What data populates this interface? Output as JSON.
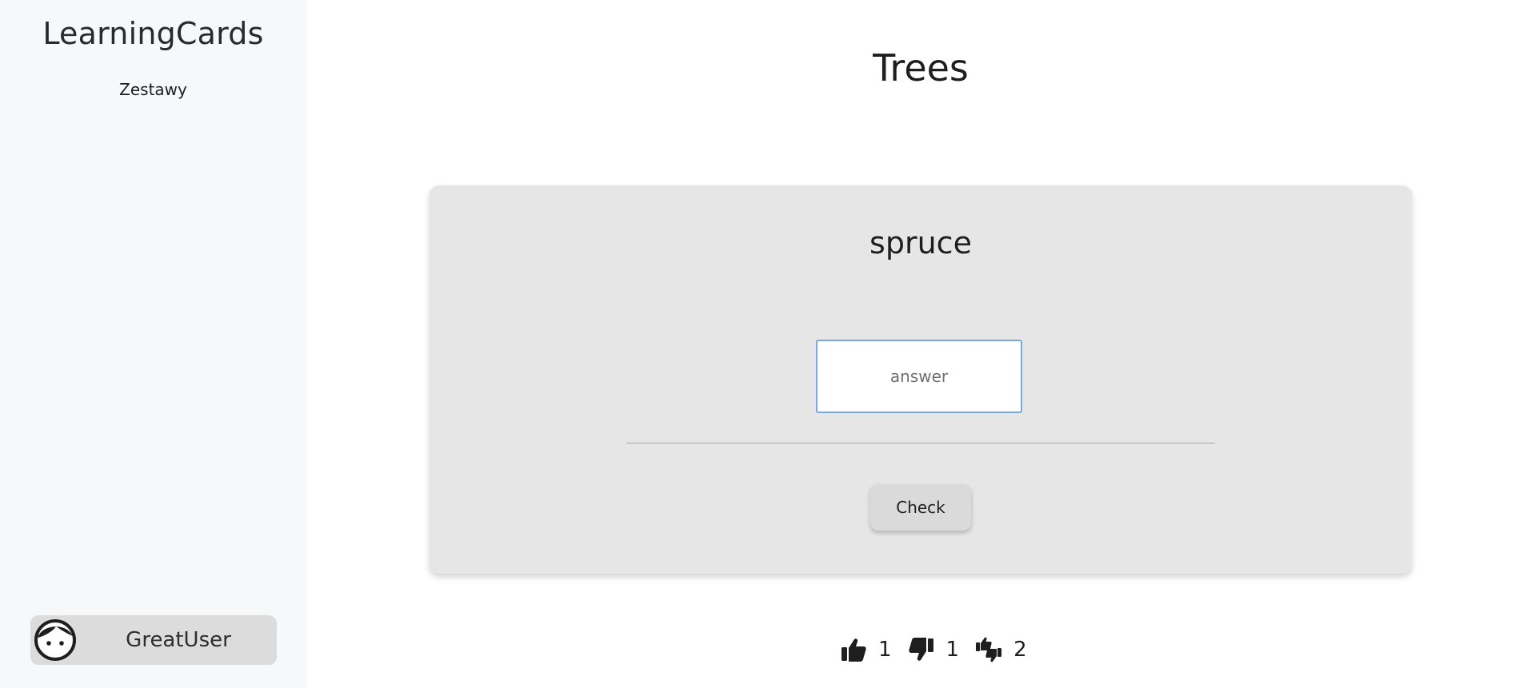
{
  "sidebar": {
    "brand": "LearningCards",
    "nav": [
      {
        "label": "Zestawy"
      }
    ],
    "user": {
      "name": "GreatUser",
      "avatar_icon": "face-icon"
    }
  },
  "main": {
    "title": "Trees",
    "card": {
      "word": "spruce",
      "answer_input": {
        "value": "",
        "placeholder": "answer"
      },
      "check_label": "Check"
    },
    "stats": {
      "correct": {
        "icon": "thumbs-up-icon",
        "count": "1"
      },
      "wrong": {
        "icon": "thumbs-down-icon",
        "count": "1"
      },
      "partial": {
        "icon": "thumbs-mixed-icon",
        "count": "2"
      }
    }
  },
  "colors": {
    "sidebar_bg": "#f7f8f9",
    "card_bg": "#e6e6e6",
    "input_focus_border": "#7aa7e6",
    "user_chip_bg": "#dcdcdc"
  }
}
